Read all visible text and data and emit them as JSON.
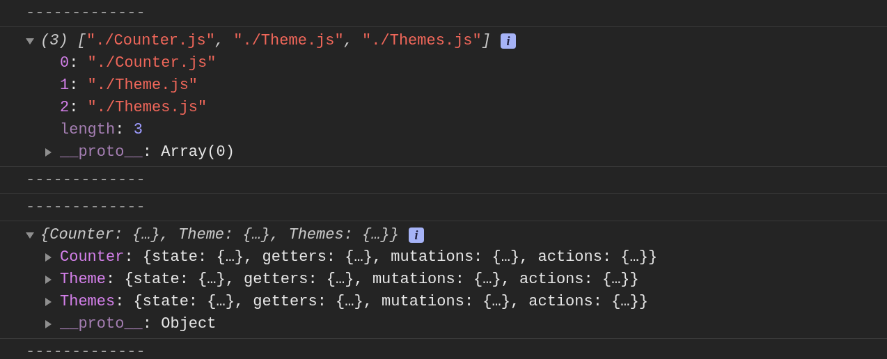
{
  "console": {
    "messages": [
      {
        "kind": "separator",
        "text": "-------------"
      },
      {
        "kind": "tree",
        "expanded": true,
        "summary": [
          {
            "text": "(3) [",
            "kind": "italic"
          },
          {
            "text": "\"./Counter.js\"",
            "kind": "string"
          },
          {
            "text": ", ",
            "kind": "italic"
          },
          {
            "text": "\"./Theme.js\"",
            "kind": "string"
          },
          {
            "text": ", ",
            "kind": "italic"
          },
          {
            "text": "\"./Themes.js\"",
            "kind": "string"
          },
          {
            "text": "]",
            "kind": "italic"
          }
        ],
        "info": "i",
        "rows": [
          {
            "kind": "index",
            "key": "0",
            "value": [
              {
                "text": ": ",
                "kind": "plain"
              },
              {
                "text": "\"./Counter.js\"",
                "kind": "string"
              }
            ]
          },
          {
            "kind": "index",
            "key": "1",
            "value": [
              {
                "text": ": ",
                "kind": "plain"
              },
              {
                "text": "\"./Theme.js\"",
                "kind": "string"
              }
            ]
          },
          {
            "kind": "index",
            "key": "2",
            "value": [
              {
                "text": ": ",
                "kind": "plain"
              },
              {
                "text": "\"./Themes.js\"",
                "kind": "string"
              }
            ]
          },
          {
            "kind": "internal",
            "key": "length",
            "value": [
              {
                "text": ": ",
                "kind": "plain"
              },
              {
                "text": "3",
                "kind": "number"
              }
            ]
          },
          {
            "kind": "internal",
            "key": "__proto__",
            "expanded": false,
            "value": [
              {
                "text": ": Array(0)",
                "kind": "plain"
              }
            ]
          }
        ]
      },
      {
        "kind": "separator",
        "text": "-------------"
      },
      {
        "kind": "separator",
        "text": "-------------"
      },
      {
        "kind": "tree",
        "expanded": true,
        "summary": [
          {
            "text": "{Counter: {…}, Theme: {…}, Themes: {…}}",
            "kind": "italic"
          }
        ],
        "info": "i",
        "rows": [
          {
            "kind": "prop",
            "key": "Counter",
            "expanded": false,
            "value": [
              {
                "text": ": {state: {…}, getters: {…}, mutations: {…}, actions: {…}}",
                "kind": "plain"
              }
            ]
          },
          {
            "kind": "prop",
            "key": "Theme",
            "expanded": false,
            "value": [
              {
                "text": ": {state: {…}, getters: {…}, mutations: {…}, actions: {…}}",
                "kind": "plain"
              }
            ]
          },
          {
            "kind": "prop",
            "key": "Themes",
            "expanded": false,
            "value": [
              {
                "text": ": {state: {…}, getters: {…}, mutations: {…}, actions: {…}}",
                "kind": "plain"
              }
            ]
          },
          {
            "kind": "internal",
            "key": "__proto__",
            "expanded": false,
            "value": [
              {
                "text": ": Object",
                "kind": "plain"
              }
            ]
          }
        ]
      },
      {
        "kind": "separator",
        "text": "-------------"
      }
    ]
  }
}
